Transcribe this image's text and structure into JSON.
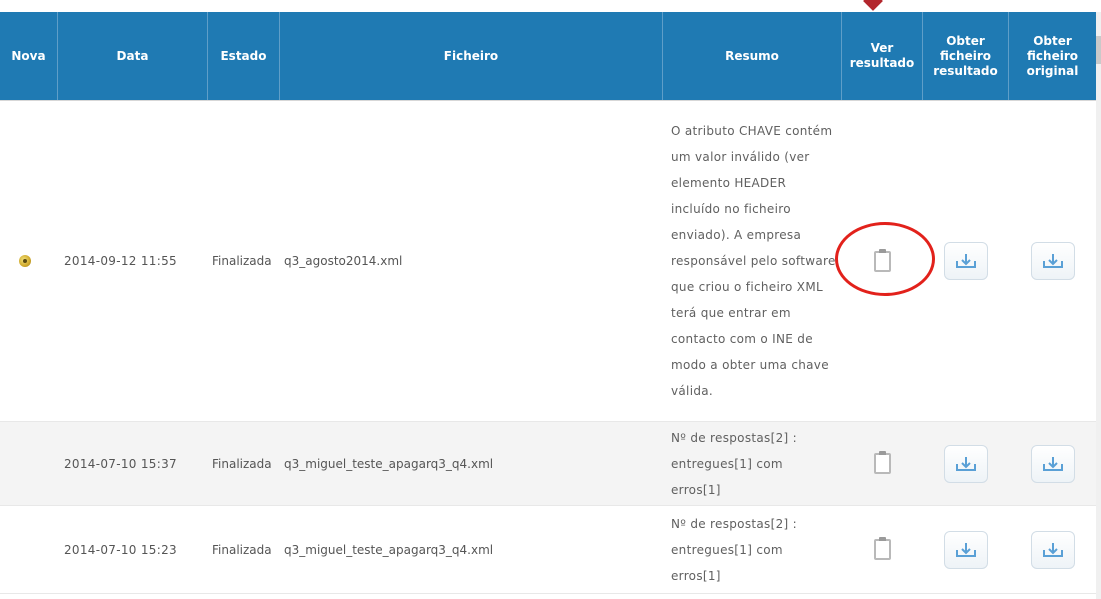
{
  "table": {
    "headers": {
      "nova": "Nova",
      "data": "Data",
      "estado": "Estado",
      "ficheiro": "Ficheiro",
      "resumo": "Resumo",
      "ver": "Ver resultado",
      "obter_resultado": "Obter ficheiro resultado",
      "obter_original": "Obter ficheiro original"
    },
    "rows": [
      {
        "nova": true,
        "data": "2014-09-12 11:55",
        "estado": "Finalizada",
        "ficheiro": "q3_agosto2014.xml",
        "resumo": "O atributo CHAVE contém um valor inválido (ver elemento HEADER incluído no ficheiro enviado). A empresa responsável pelo software que criou o ficheiro XML terá que entrar em contacto com o INE de modo a obter uma chave válida."
      },
      {
        "nova": false,
        "data": "2014-07-10 15:37",
        "estado": "Finalizada",
        "ficheiro": "q3_miguel_teste_apagarq3_q4.xml",
        "resumo": "Nº de respostas[2] : entregues[1] com erros[1]"
      },
      {
        "nova": false,
        "data": "2014-07-10 15:23",
        "estado": "Finalizada",
        "ficheiro": "q3_miguel_teste_apagarq3_q4.xml",
        "resumo": "Nº de respostas[2] : entregues[1] com erros[1]"
      }
    ]
  },
  "icons": {
    "new": "new-indicator-icon",
    "view": "clipboard-icon",
    "download": "download-icon"
  },
  "colors": {
    "header_bg": "#1f7ab3",
    "highlight_circle": "#e2211b",
    "alt_row_bg": "#f4f4f4"
  }
}
